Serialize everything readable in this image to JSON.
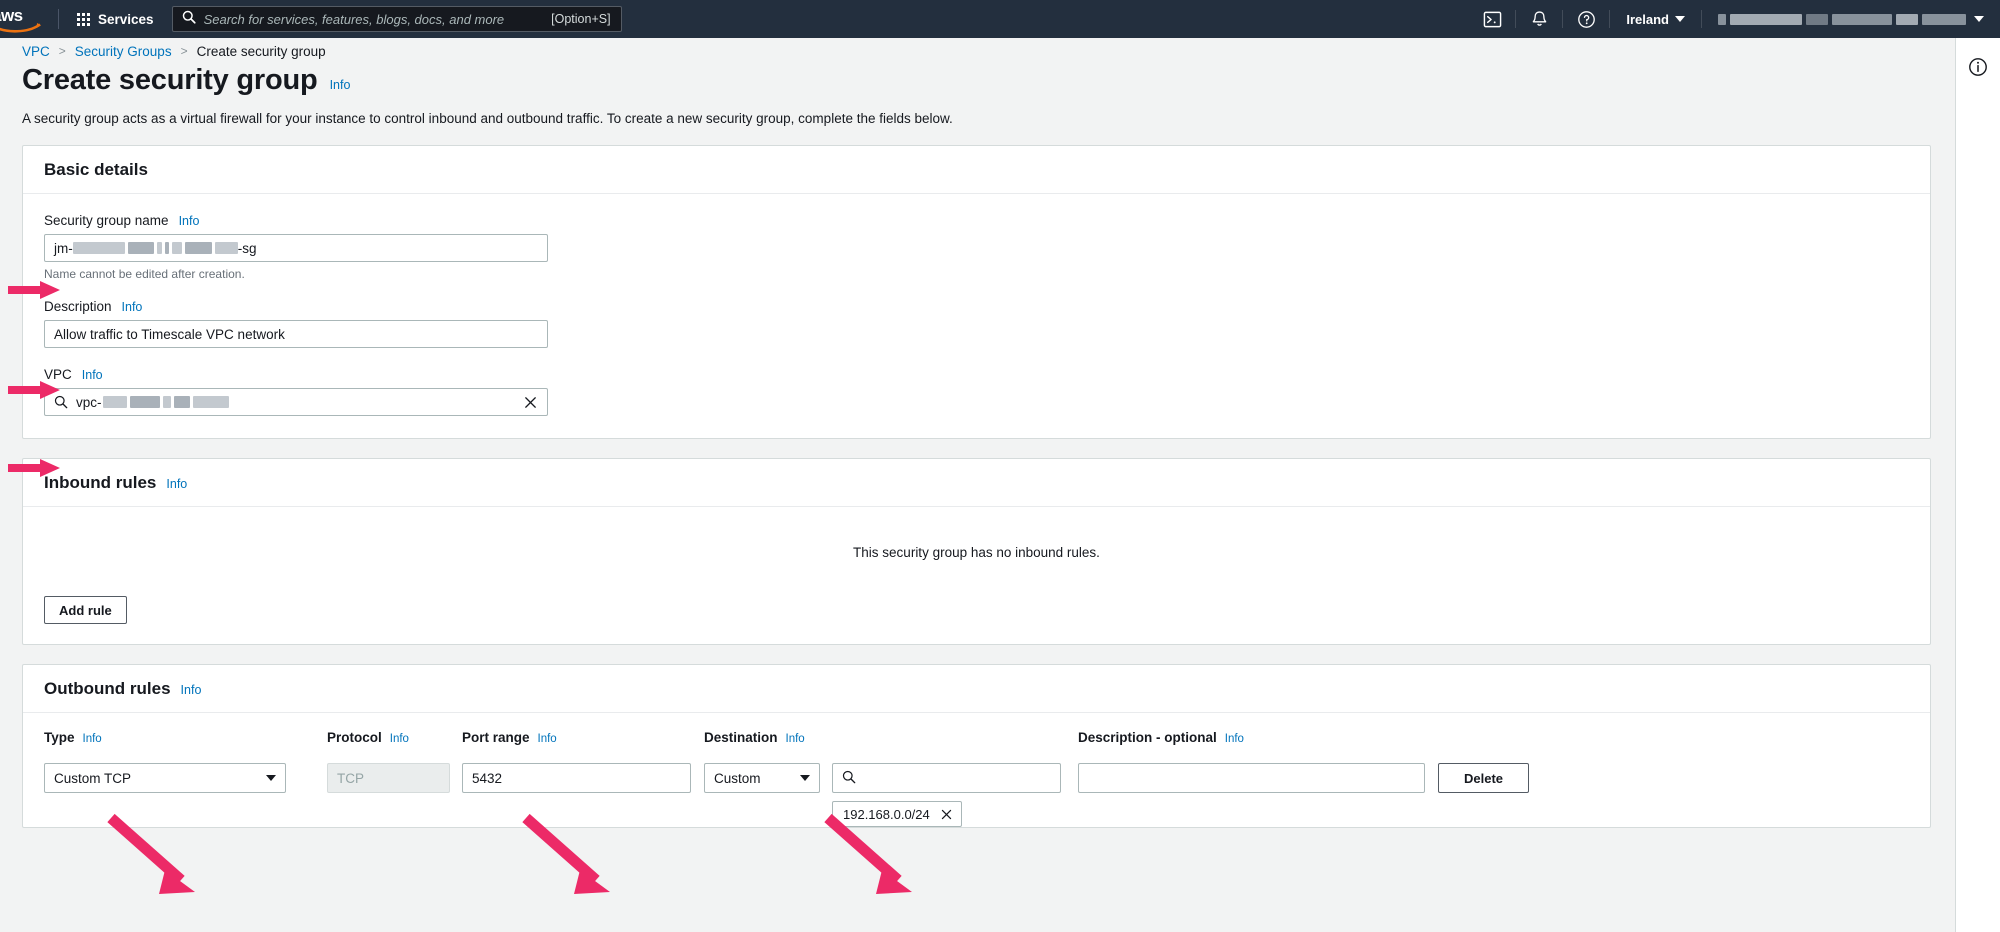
{
  "topnav": {
    "logo_alt": "aws",
    "services_label": "Services",
    "search_placeholder": "Search for services, features, blogs, docs, and more",
    "search_value": "",
    "search_hint": "[Option+S]",
    "cloudshell_icon": "cloudshell-icon",
    "notifications_icon": "bell-icon",
    "help_icon": "question-circle-icon",
    "region_label": "Ireland",
    "account_label": ""
  },
  "breadcrumb": {
    "items": [
      {
        "label": "VPC",
        "current": false
      },
      {
        "label": "Security Groups",
        "current": false
      },
      {
        "label": "Create security group",
        "current": true
      }
    ],
    "separator": ">"
  },
  "page": {
    "title": "Create security group",
    "info_label": "Info",
    "description": "A security group acts as a virtual firewall for your instance to control inbound and outbound traffic. To create a new security group, complete the fields below."
  },
  "basic_details": {
    "title": "Basic details",
    "info_label": "Info",
    "security_group_name": {
      "label": "Security group name",
      "info_label": "Info",
      "value_prefix": "jm-",
      "value_suffix": "-sg",
      "hint": "Name cannot be edited after creation."
    },
    "description": {
      "label": "Description",
      "info_label": "Info",
      "value": "Allow traffic to Timescale VPC network"
    },
    "vpc": {
      "label": "VPC",
      "info_label": "Info",
      "value_prefix": "vpc-",
      "search_icon": "search-icon",
      "clear_icon": "close-icon"
    }
  },
  "inbound_rules": {
    "title": "Inbound rules",
    "info_label": "Info",
    "empty_message": "This security group has no inbound rules.",
    "add_rule_label": "Add rule"
  },
  "outbound_rules": {
    "title": "Outbound rules",
    "info_label": "Info",
    "columns": {
      "type": "Type",
      "protocol": "Protocol",
      "port_range": "Port range",
      "destination": "Destination",
      "source_search": "",
      "description": "Description - optional",
      "info_label": "Info"
    },
    "row": {
      "type_value": "Custom TCP",
      "protocol_value": "TCP",
      "port_range_value": "5432",
      "destination_value": "Custom",
      "cidr_search_value": "",
      "cidr_token": "192.168.0.0/24",
      "cidr_token_remove_icon": "close-icon",
      "description_value": "",
      "delete_label": "Delete"
    }
  },
  "right_rail": {
    "info_icon": "info-circle-icon"
  },
  "colors": {
    "nav_bg": "#232f3e",
    "page_bg": "#f2f3f3",
    "card_bg": "#ffffff",
    "link": "#0073bb",
    "text": "#16191f",
    "border": "#aab7b8",
    "annotation_arrow": "#ec2a67"
  },
  "annotations": {
    "arrow_color": "#ec2a67",
    "arrows": [
      {
        "name": "arrow-security-group-name",
        "target": "security-group-name-input"
      },
      {
        "name": "arrow-description",
        "target": "description-input"
      },
      {
        "name": "arrow-vpc",
        "target": "vpc-select"
      },
      {
        "name": "arrow-type",
        "target": "outbound-type-select"
      },
      {
        "name": "arrow-port-range",
        "target": "outbound-port-range-input"
      },
      {
        "name": "arrow-destination-search",
        "target": "outbound-destination-search-input"
      }
    ]
  }
}
